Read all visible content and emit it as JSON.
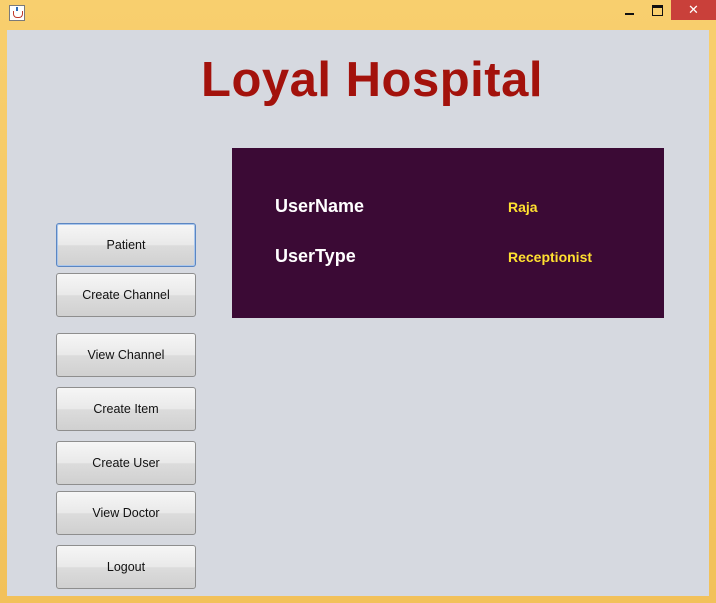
{
  "window": {
    "title": "",
    "controls": {
      "minimize_icon": "minimize-icon",
      "maximize_icon": "maximize-icon",
      "close_glyph": "✕"
    }
  },
  "header": {
    "title": "Loyal Hospital",
    "title_color": "#a3120c"
  },
  "info_panel": {
    "background": "#3b0a35",
    "username_label": "UserName",
    "username_value": "Raja",
    "usertype_label": "UserType",
    "usertype_value": "Receptionist",
    "value_color": "#ffe030"
  },
  "menu": {
    "buttons": [
      {
        "label": "Patient"
      },
      {
        "label": "Create Channel"
      },
      {
        "label": "View Channel"
      },
      {
        "label": "Create Item"
      },
      {
        "label": "Create User"
      },
      {
        "label": "View Doctor"
      },
      {
        "label": "Logout"
      }
    ]
  }
}
